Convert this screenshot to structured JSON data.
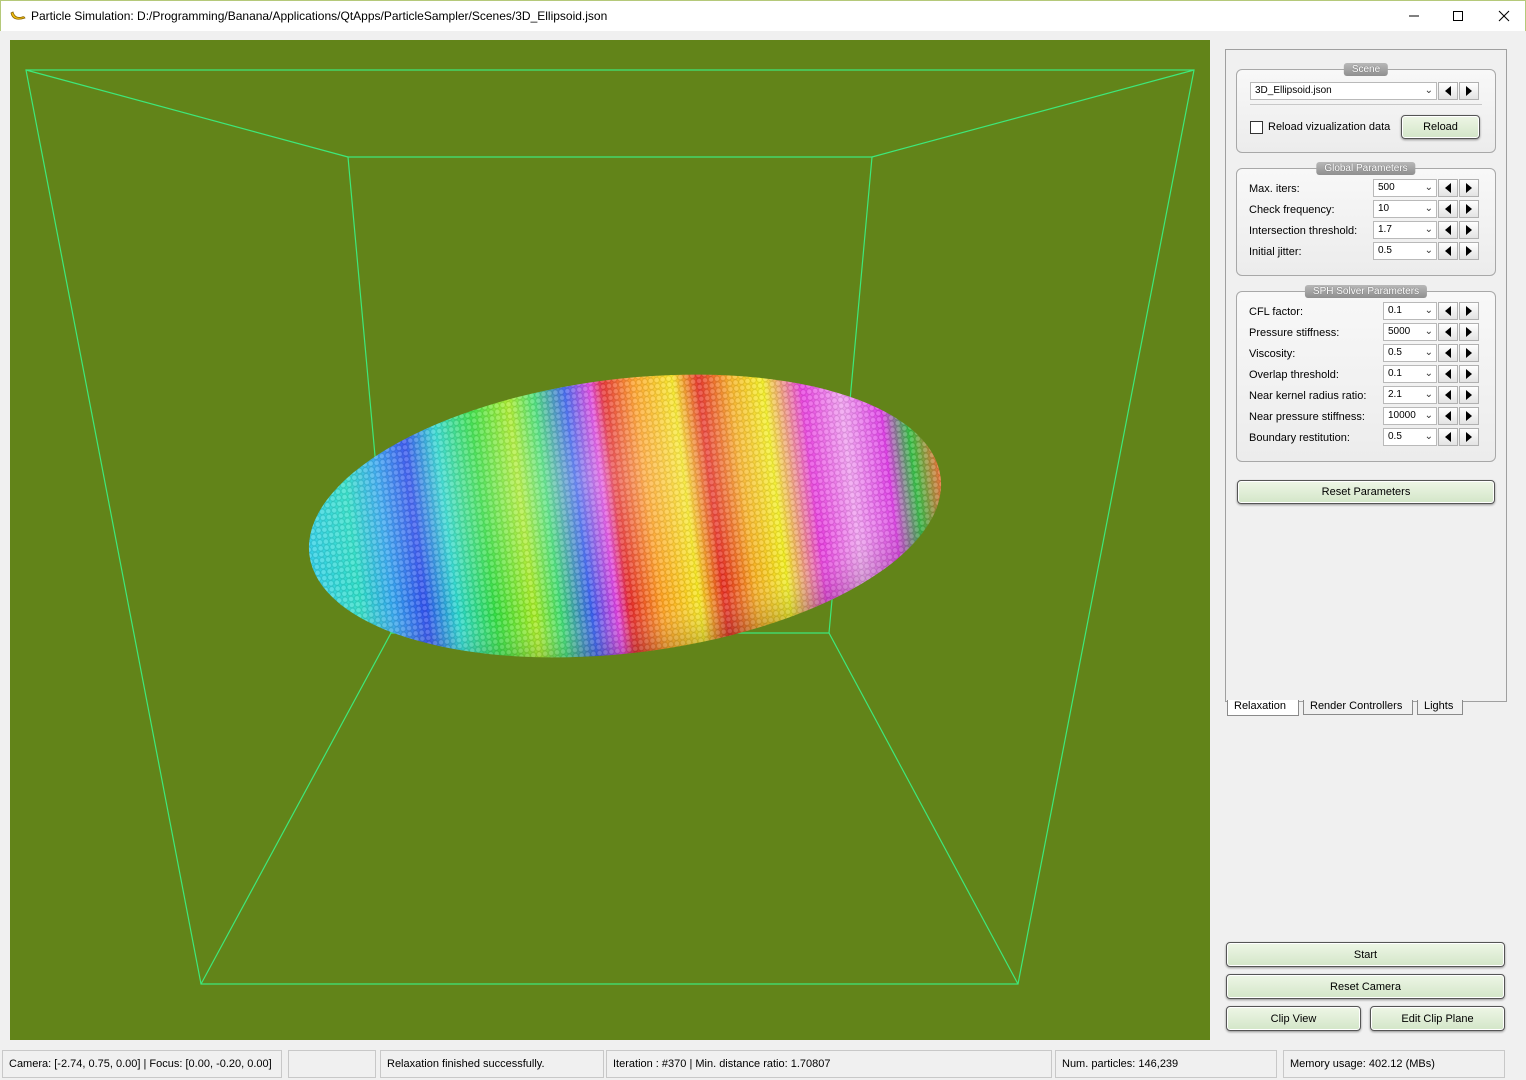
{
  "window": {
    "title": "Particle Simulation: D:/Programming/Banana/Applications/QtApps/ParticleSampler/Scenes/3D_Ellipsoid.json",
    "app_icon": "banana-icon"
  },
  "viewport": {
    "background": "#628419",
    "box_color": "#3ee87a"
  },
  "scene": {
    "title": "Scene",
    "file": "3D_Ellipsoid.json",
    "reload_checkbox_label": "Reload vizualization data",
    "reload_checked": false,
    "reload_button": "Reload"
  },
  "global_params": {
    "title": "Global Parameters",
    "rows": [
      {
        "label": "Max. iters:",
        "value": "500"
      },
      {
        "label": "Check frequency:",
        "value": "10"
      },
      {
        "label": "Intersection threshold:",
        "value": "1.7"
      },
      {
        "label": "Initial jitter:",
        "value": "0.5"
      }
    ]
  },
  "sph_params": {
    "title": "SPH Solver Parameters",
    "rows": [
      {
        "label": "CFL factor:",
        "value": "0.1"
      },
      {
        "label": "Pressure stiffness:",
        "value": "5000"
      },
      {
        "label": "Viscosity:",
        "value": "0.5"
      },
      {
        "label": "Overlap threshold:",
        "value": "0.1"
      },
      {
        "label": "Near kernel radius ratio:",
        "value": "2.1"
      },
      {
        "label": "Near pressure stiffness:",
        "value": "10000"
      },
      {
        "label": "Boundary restitution:",
        "value": "0.5"
      }
    ]
  },
  "reset_parameters": "Reset Parameters",
  "tabs": [
    "Relaxation",
    "Render Controllers",
    "Lights"
  ],
  "buttons": {
    "start": "Start",
    "reset_camera": "Reset Camera",
    "clip_view": "Clip View",
    "edit_clip_plane": "Edit Clip Plane"
  },
  "status": {
    "camera": "Camera: [-2.74, 0.75, 0.00] | Focus: [0.00, -0.20, 0.00]",
    "progress": "",
    "message": "Relaxation finished successfully.",
    "iteration": "Iteration : #370 | Min. distance ratio: 1.70807",
    "particles": "Num. particles: 146,239",
    "memory": "Memory usage: 402.12 (MBs)"
  }
}
